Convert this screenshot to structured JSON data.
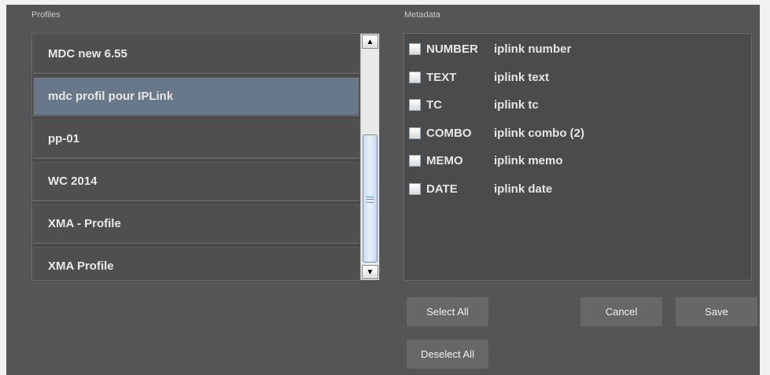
{
  "profiles": {
    "title": "Profiles",
    "items": [
      {
        "label": "MDC new 6.55"
      },
      {
        "label": "mdc profil pour IPLink",
        "selected": true
      },
      {
        "label": "pp-01"
      },
      {
        "label": "WC 2014"
      },
      {
        "label": "XMA - Profile"
      },
      {
        "label": "XMA Profile"
      }
    ]
  },
  "metadata": {
    "title": "Metadata",
    "items": [
      {
        "key": "NUMBER",
        "value": "iplink number",
        "checked": false
      },
      {
        "key": "TEXT",
        "value": "iplink text",
        "checked": false
      },
      {
        "key": "TC",
        "value": "iplink tc",
        "checked": false
      },
      {
        "key": "COMBO",
        "value": "iplink combo (2)",
        "checked": false
      },
      {
        "key": "MEMO",
        "value": "iplink memo",
        "checked": false
      },
      {
        "key": "DATE",
        "value": "iplink date",
        "checked": false
      }
    ]
  },
  "buttons": {
    "select_all": "Select All",
    "deselect_all": "Deselect All",
    "cancel": "Cancel",
    "save": "Save"
  },
  "icons": {
    "scroll_up": "▲",
    "scroll_down": "▼"
  },
  "colors": {
    "background": "#555555",
    "selected_item": "#687789",
    "button": "#676767"
  }
}
